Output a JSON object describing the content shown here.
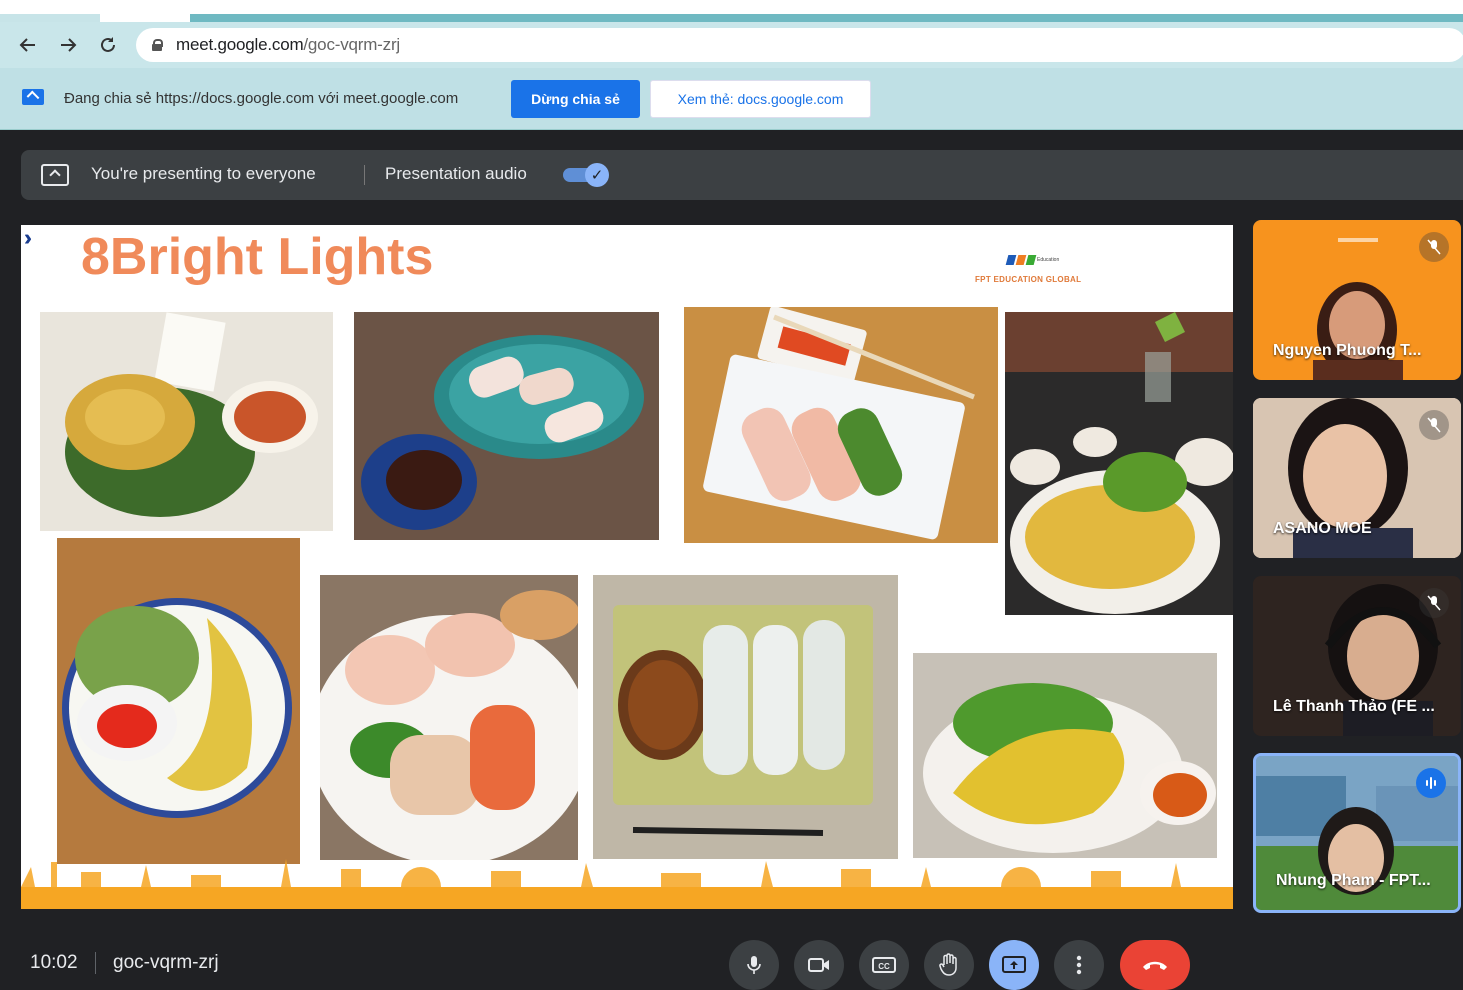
{
  "browser": {
    "url_host": "meet.google.com",
    "url_path": "/goc-vqrm-zrj"
  },
  "share_bar": {
    "message": "Đang chia sẻ https://docs.google.com với meet.google.com",
    "stop_label": "Dừng chia sẻ",
    "view_label": "Xem thẻ: docs.google.com"
  },
  "presenting": {
    "status": "You're presenting to everyone",
    "audio_label": "Presentation audio",
    "audio_on": true
  },
  "slide": {
    "title": "8Bright Lights",
    "logo_text": "FPT EDUCATION GLOBAL",
    "logo_small": "Education"
  },
  "participants": [
    {
      "name": "Nguyen Phuong T...",
      "muted": true
    },
    {
      "name": "ASANO MOE",
      "muted": true
    },
    {
      "name": "Lê Thanh Thảo (FE ...",
      "muted": true
    },
    {
      "name": "Nhung Pham - FPT...",
      "speaking": true
    }
  ],
  "bottom": {
    "time": "10:02",
    "meeting_code": "goc-vqrm-zrj"
  },
  "icons": [
    "back-icon",
    "forward-icon",
    "reload-icon",
    "lock-icon",
    "share-tab-icon",
    "present-icon",
    "check-icon",
    "mic-icon",
    "camera-icon",
    "captions-icon",
    "raise-hand-icon",
    "present-screen-icon",
    "more-options-icon",
    "end-call-icon",
    "mic-off-icon",
    "audio-level-icon"
  ],
  "colors": {
    "accent_blue": "#1a73e8",
    "title_orange": "#f08a5a",
    "end_call_red": "#ea4335",
    "meet_bg": "#202124"
  }
}
